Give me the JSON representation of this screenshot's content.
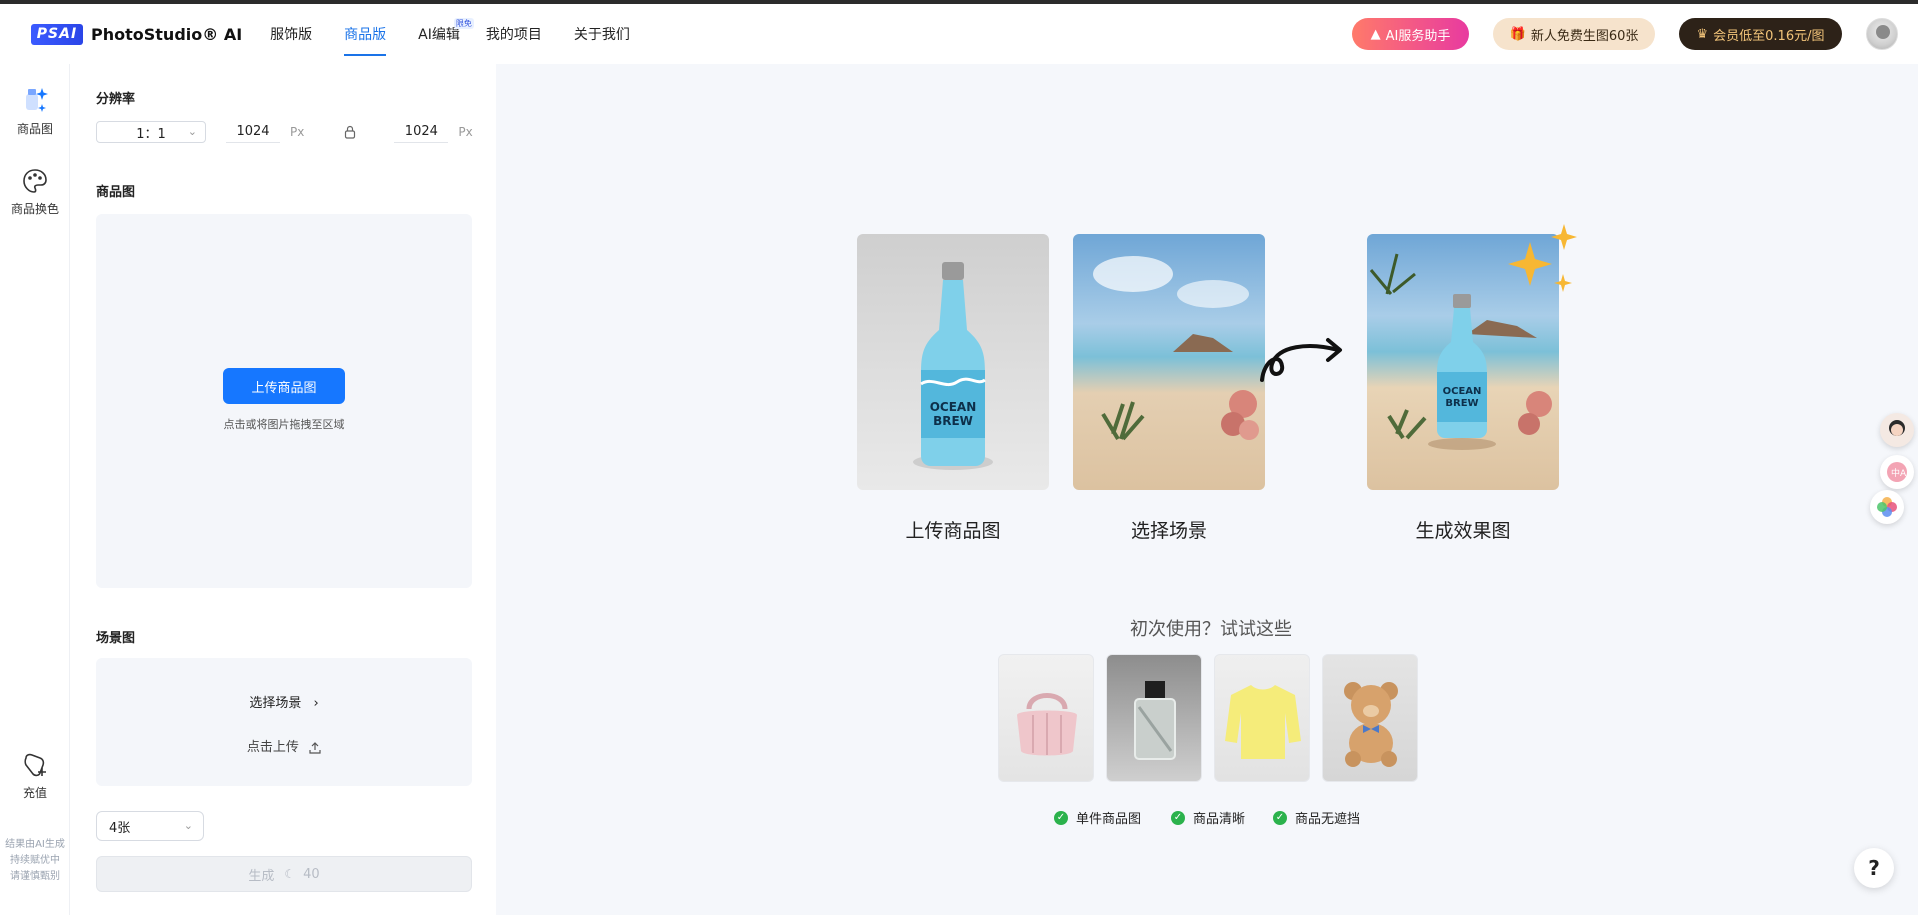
{
  "brand": {
    "badge": "PSAI",
    "name": "PhotoStudio® AI"
  },
  "nav": [
    {
      "label": "服饰版",
      "active": false
    },
    {
      "label": "商品版",
      "active": true
    },
    {
      "label": "AI编辑",
      "tag": "限免",
      "active": false
    },
    {
      "label": "我的项目",
      "active": false
    },
    {
      "label": "关于我们",
      "active": false
    }
  ],
  "header_actions": {
    "ai_assistant": "AI服务助手",
    "new_user_offer": "新人免费生图60张",
    "vip_offer": "会员低至0.16元/图"
  },
  "rail": {
    "items": [
      {
        "label": "商品图",
        "icon": "product-image-icon"
      },
      {
        "label": "商品换色",
        "icon": "palette-icon"
      }
    ],
    "recharge": "充值",
    "note_lines": [
      "结果由AI生成",
      "持续赋优中",
      "请谨慎甄别"
    ]
  },
  "panel": {
    "resolution_title": "分辨率",
    "ratio": "1：1",
    "width": "1024",
    "height": "1024",
    "px_unit": "Px",
    "product_title": "商品图",
    "upload_button": "上传商品图",
    "upload_hint": "点击或将图片拖拽至区域",
    "scene_title": "场景图",
    "choose_scene": "选择场景",
    "click_upload": "点击上传",
    "count": "4张",
    "generate_label": "生成",
    "generate_cost": "40"
  },
  "demo": {
    "steps": [
      "上传商品图",
      "选择场景",
      "生成效果图"
    ],
    "bottle_text": [
      "OCEAN",
      "BREW"
    ]
  },
  "try": {
    "title": "初次使用？试试这些",
    "samples": [
      "handbag",
      "perfume",
      "sweater",
      "teddy-bear"
    ],
    "requirements": [
      "单件商品图",
      "商品清晰",
      "商品无遮挡"
    ]
  },
  "colors": {
    "primary": "#1677ff",
    "active_nav": "#1a73e8",
    "check": "#2bb24c"
  }
}
